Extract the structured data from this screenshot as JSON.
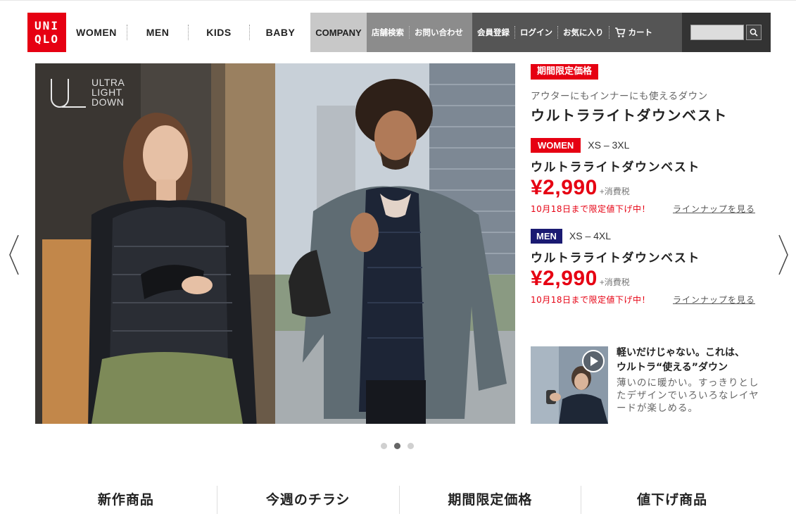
{
  "logo": {
    "line1": "UNI",
    "line2": "QLO"
  },
  "nav": {
    "main": [
      "WOMEN",
      "MEN",
      "KIDS",
      "BABY"
    ],
    "company": "COMPANY",
    "store_search": "店舗検索",
    "contact": "お問い合わせ",
    "register": "会員登録",
    "login": "ログイン",
    "favorites": "お気に入り",
    "cart": "カート"
  },
  "search": {
    "placeholder": ""
  },
  "hero": {
    "logo_text": [
      "ULTRA",
      "LIGHT",
      "DOWN"
    ]
  },
  "promo": {
    "badge": "期間限定価格",
    "subtitle": "アウターにもインナーにも使えるダウン",
    "title": "ウルトラライトダウンベスト",
    "women": {
      "tag": "WOMEN",
      "size": "XS – 3XL",
      "name": "ウルトラライトダウンベスト",
      "price": "¥2,990",
      "tax": "+消費税",
      "note": "10月18日まで限定値下げ中！",
      "link": "ラインナップを見る"
    },
    "men": {
      "tag": "MEN",
      "size": "XS – 4XL",
      "name": "ウルトラライトダウンベスト",
      "price": "¥2,990",
      "tax": "+消費税",
      "note": "10月18日まで限定値下げ中！",
      "link": "ラインナップを見る"
    }
  },
  "video": {
    "title_line1": "軽いだけじゃない。これは、",
    "title_line2": "ウルトラ“使える”ダウン",
    "text": "薄いのに暖かい。すっきりとしたデザインでいろいろなレイヤードが楽しめる。"
  },
  "carousel": {
    "slides": 3,
    "active": 2
  },
  "bottom_tabs": [
    "新作商品",
    "今週のチラシ",
    "期間限定価格",
    "値下げ商品"
  ],
  "colors": {
    "brand_red": "#e60012",
    "men_navy": "#1a1a72"
  },
  "icons": {
    "search": "search-icon",
    "cart": "cart-icon",
    "prev": "chevron-left-icon",
    "next": "chevron-right-icon",
    "play": "play-icon"
  }
}
